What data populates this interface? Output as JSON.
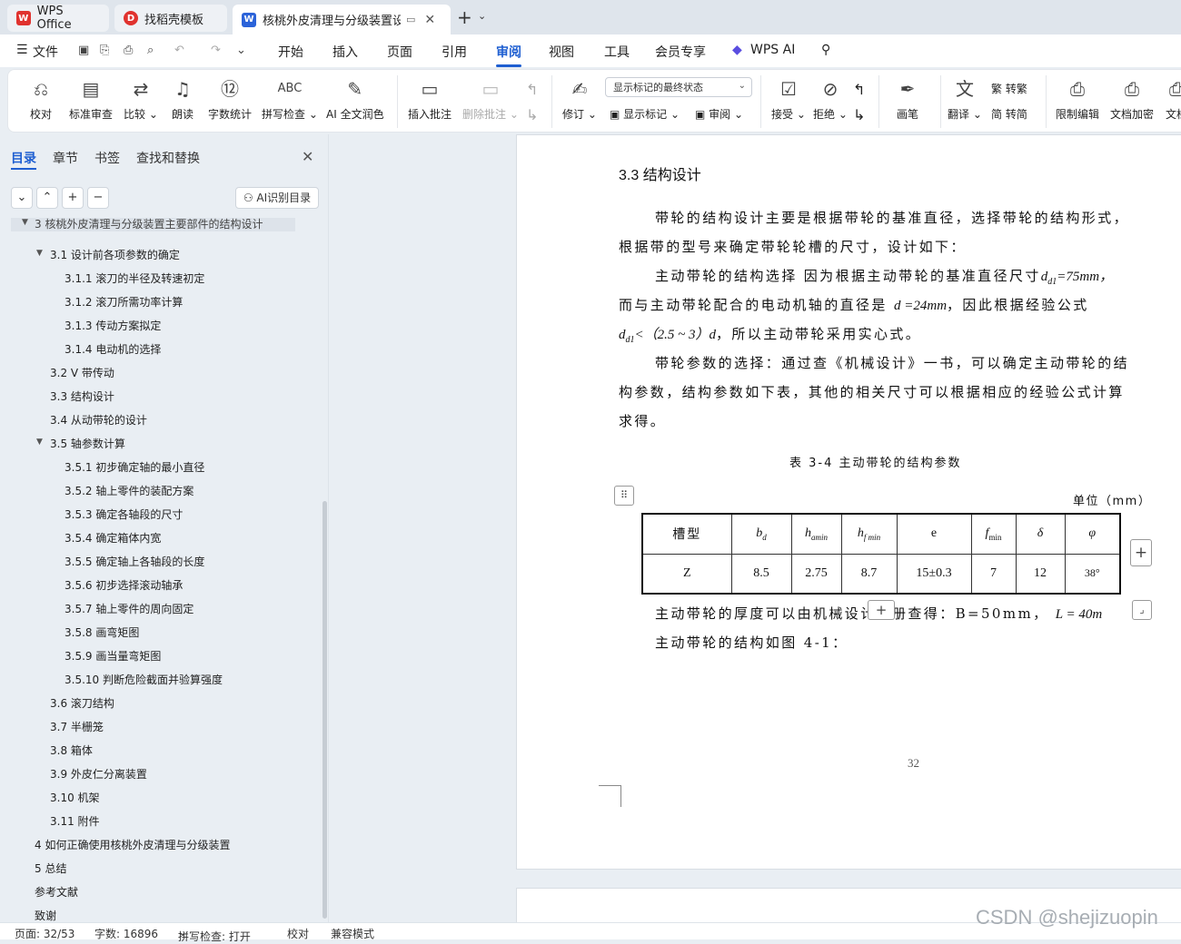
{
  "tabs": [
    {
      "label": "WPS Office",
      "icon": "wps-logo-icon"
    },
    {
      "label": "找稻壳模板",
      "icon": "docer-icon"
    },
    {
      "label": "核桃外皮清理与分级装置设计",
      "icon": "word-doc-icon"
    }
  ],
  "menu": {
    "file": "文件",
    "items": [
      "开始",
      "插入",
      "页面",
      "引用",
      "审阅",
      "视图",
      "工具",
      "会员专享"
    ],
    "active": "审阅",
    "wps_ai": "WPS AI"
  },
  "ribbon": {
    "proofread": "校对",
    "std_review": "标准审查",
    "compare": "比较",
    "read_aloud": "朗读",
    "word_count": "字数统计",
    "spell_check": "拼写检查",
    "ai_polish": "AI 全文润色",
    "insert_comment": "插入批注",
    "delete_comment": "删除批注",
    "revise": "修订",
    "markup_state": "显示标记的最终状态",
    "show_markup": "显示标记",
    "review": "审阅",
    "accept": "接受",
    "reject": "拒绝",
    "pen": "画笔",
    "translate": "翻译",
    "to_traditional": "转繁",
    "to_simplified": "转简",
    "restrict_edit": "限制编辑",
    "doc_encrypt": "文档加密",
    "doc_more": "文档"
  },
  "nav": {
    "tabs": [
      "目录",
      "章节",
      "书签",
      "查找和替换"
    ],
    "ai_toc": "AI识别目录",
    "toc": [
      {
        "label": "3   核桃外皮清理与分级装置主要部件的结构设计",
        "level": 0
      },
      {
        "label": "3.1 设计前各项参数的确定",
        "level": 1,
        "expanded": true
      },
      {
        "label": "3.1.1 滚刀的半径及转速初定",
        "level": 2
      },
      {
        "label": "3.1.2 滚刀所需功率计算",
        "level": 2
      },
      {
        "label": "3.1.3 传动方案拟定",
        "level": 2
      },
      {
        "label": "3.1.4 电动机的选择",
        "level": 2
      },
      {
        "label": "3.2 V 带传动",
        "level": 1
      },
      {
        "label": "3.3 结构设计",
        "level": 1
      },
      {
        "label": "3.4 从动带轮的设计",
        "level": 1
      },
      {
        "label": "3.5 轴参数计算",
        "level": 1,
        "expanded": true
      },
      {
        "label": "3.5.1 初步确定轴的最小直径",
        "level": 2
      },
      {
        "label": "3.5.2 轴上零件的装配方案",
        "level": 2
      },
      {
        "label": "3.5.3 确定各轴段的尺寸",
        "level": 2
      },
      {
        "label": "3.5.4 确定箱体内宽",
        "level": 2
      },
      {
        "label": "3.5.5 确定轴上各轴段的长度",
        "level": 2
      },
      {
        "label": "3.5.6 初步选择滚动轴承",
        "level": 2
      },
      {
        "label": "3.5.7 轴上零件的周向固定",
        "level": 2
      },
      {
        "label": "3.5.8 画弯矩图",
        "level": 2
      },
      {
        "label": "3.5.9 画当量弯矩图",
        "level": 2
      },
      {
        "label": "3.5.10 判断危险截面并验算强度",
        "level": 2
      },
      {
        "label": "3.6 滚刀结构",
        "level": 1
      },
      {
        "label": "3.7 半栅笼",
        "level": 1
      },
      {
        "label": "3.8 箱体",
        "level": 1
      },
      {
        "label": "3.9 外皮仁分离装置",
        "level": 1
      },
      {
        "label": "3.10 机架",
        "level": 1
      },
      {
        "label": "3.11 附件",
        "level": 1
      },
      {
        "label": "4   如何正确使用核桃外皮清理与分级装置",
        "level": 0
      },
      {
        "label": "5   总结",
        "level": 0
      },
      {
        "label": "参考文献",
        "level": 0
      },
      {
        "label": "致谢",
        "level": 0
      }
    ]
  },
  "doc": {
    "heading": "3.3  结构设计",
    "p1a": "带轮的结构设计主要是根据带轮的基准直径，选择带轮的结构形式，",
    "p1b": "根据带的型号来确定带轮轮槽的尺寸，设计如下：",
    "p2a": "主动带轮的结构选择  因为根据主动带轮的基准直径尺寸",
    "p2a_math": "d",
    "p2a_sub": "d1",
    "p2a_eq": "=75mm，",
    "p2b": "而与主动带轮配合的电动机轴的直径是",
    "p2b_math": "d =24mm",
    "p2b_tail": "，因此根据经验公式",
    "p2c_math": "d",
    "p2c_sub": "d1",
    "p2c_expr": "<（2.5 ~ 3）d",
    "p2c_tail": "，所以主动带轮采用实心式。",
    "p3a": "带轮参数的选择：通过查《机械设计》一书，可以确定主动带轮的结",
    "p3b": "构参数，结构参数如下表，其他的相关尺寸可以根据相应的经验公式计算",
    "p3c": "求得。",
    "table_caption": "表 3-4   主动带轮的结构参数",
    "table_unit": "单位（mm）",
    "table_header": [
      "槽型",
      "b",
      "h",
      "h",
      "e",
      "f",
      "δ",
      "φ"
    ],
    "table_header_sub": [
      "",
      "d",
      "amin",
      "f min",
      "",
      "min",
      "",
      ""
    ],
    "table_row": [
      "Z",
      "8.5",
      "2.75",
      "8.7",
      "15±0.3",
      "7",
      "12",
      "38°"
    ],
    "p4": "主动带轮的厚度可以由机械设计手册查得：B=50mm，",
    "p4_math": "L = 40m",
    "p5": "主动带轮的结构如图 4-1：",
    "page_number": "32"
  },
  "status": {
    "page": "页面: 32/53",
    "words": "字数: 16896",
    "spell": "拼写检查: 打开",
    "proof": "校对",
    "compat": "兼容模式"
  },
  "watermark": "CSDN @shejizuopin",
  "colors": {
    "accent": "#1f5fd1",
    "wps_red": "#e0322e",
    "word_blue": "#2b63d9"
  }
}
